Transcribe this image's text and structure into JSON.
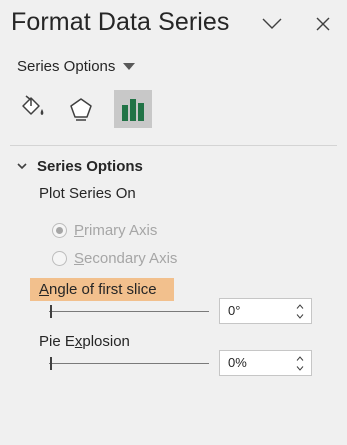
{
  "pane": {
    "title": "Format Data Series",
    "dropdown_label": "Series Options",
    "tabs": [
      {
        "icon": "fill-line-icon",
        "active": false
      },
      {
        "icon": "effects-icon",
        "active": false
      },
      {
        "icon": "series-options-icon",
        "active": true
      }
    ]
  },
  "section": {
    "title": "Series Options",
    "plot_series_on": "Plot Series On",
    "primary_axis": {
      "prefix": "",
      "key": "P",
      "rest": "rimary Axis",
      "checked": true,
      "enabled": false
    },
    "secondary_axis": {
      "prefix": "",
      "key": "S",
      "rest": "econdary Axis",
      "checked": false,
      "enabled": false
    },
    "angle": {
      "prefix": "",
      "key": "A",
      "rest": "ngle of first slice",
      "value": "0°"
    },
    "explosion": {
      "prefix": "Pie E",
      "key": "x",
      "rest": "plosion",
      "value": "0%"
    }
  },
  "colors": {
    "background": "#f0f0f0",
    "active_tab": "#c8c8c8",
    "highlight": "#f2c08d",
    "chart_icon_green": "#217346"
  }
}
